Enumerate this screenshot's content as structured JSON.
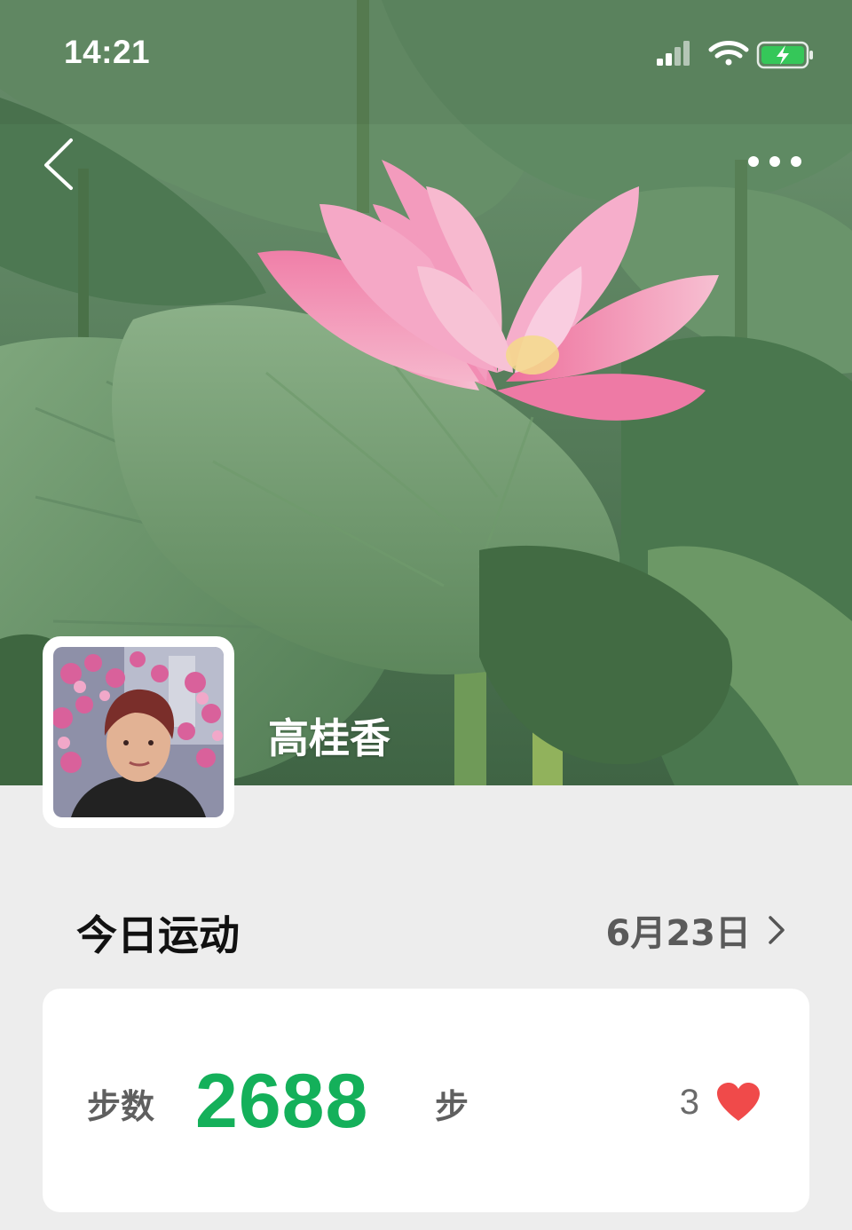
{
  "status_bar": {
    "time": "14:21",
    "icons": [
      "signal-icon",
      "wifi-icon",
      "battery-charging-icon"
    ]
  },
  "nav": {
    "back_icon": "chevron-left-icon",
    "more_icon": "more-dots-icon"
  },
  "profile": {
    "name": "高桂香",
    "cover_image": "lotus-flower-photo",
    "avatar_image": "user-photo"
  },
  "today": {
    "title": "今日运动",
    "date": "6月23日"
  },
  "steps": {
    "label": "步数",
    "value": "2688",
    "unit": "步",
    "likes": "3"
  },
  "colors": {
    "accent": "#14b05a",
    "like": "#f04a4a",
    "background": "#ededed"
  }
}
